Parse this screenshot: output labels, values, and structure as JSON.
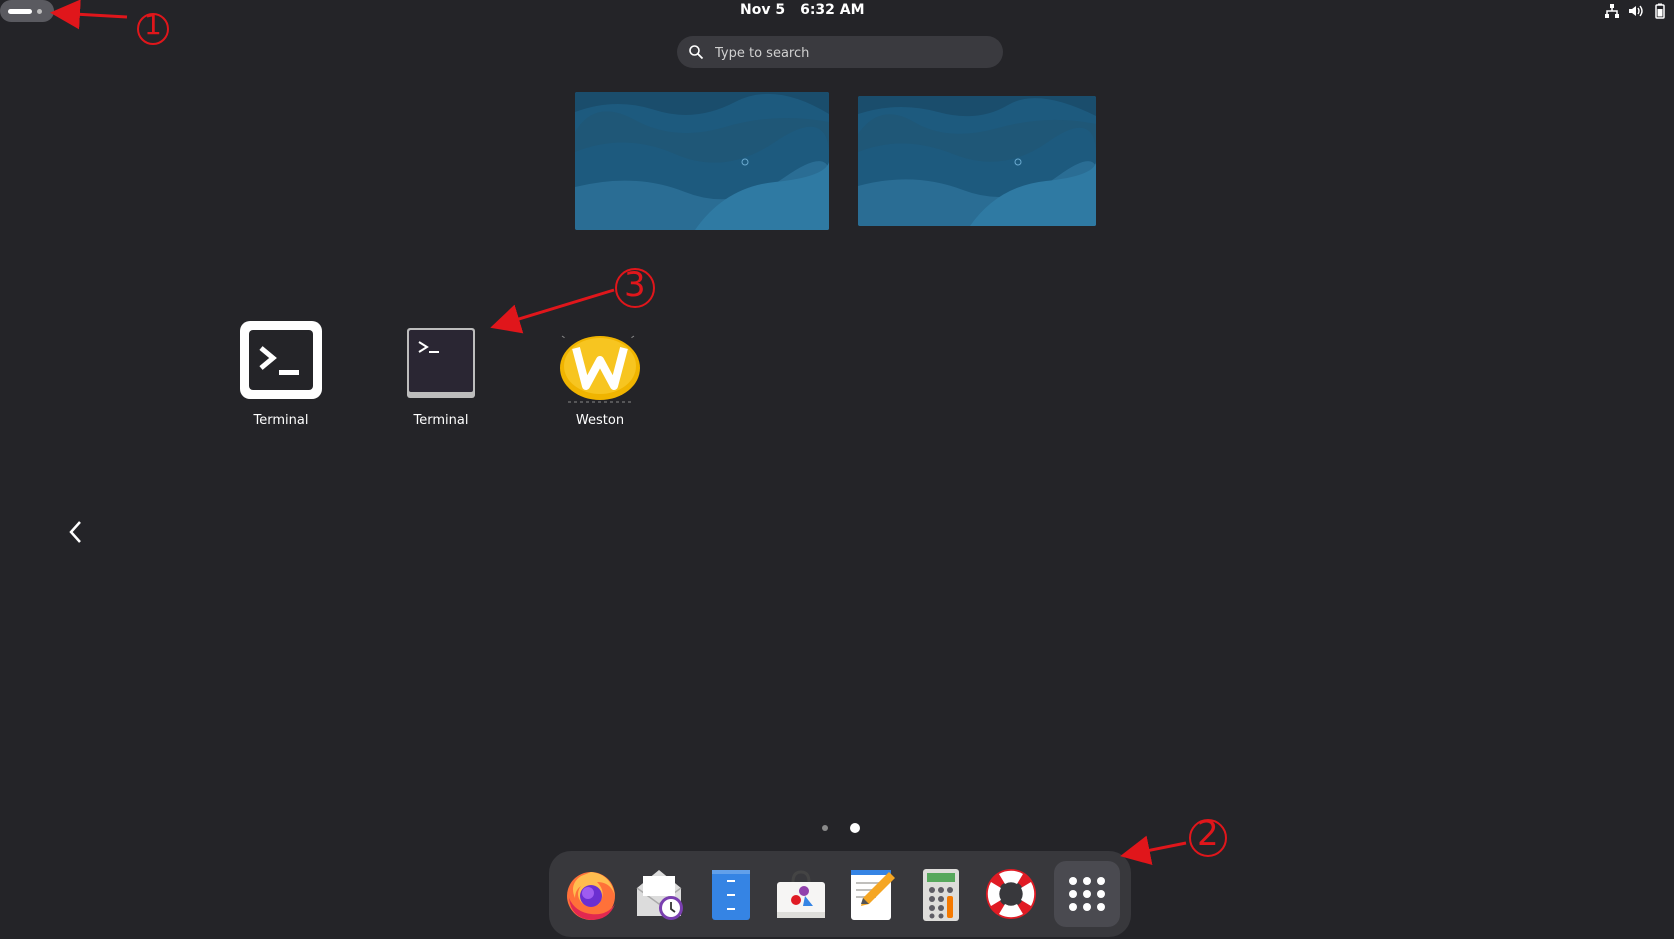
{
  "topbar": {
    "date": "Nov 5",
    "time": "6:32 AM",
    "tray_icons": [
      "network-icon",
      "volume-icon",
      "battery-icon"
    ]
  },
  "search": {
    "placeholder": "Type to search"
  },
  "app_grid": {
    "apps": [
      {
        "label": "Terminal",
        "icon": "terminal-icon"
      },
      {
        "label": "Terminal",
        "icon": "terminal-dark-icon"
      },
      {
        "label": "Weston",
        "icon": "weston-icon"
      }
    ],
    "pages": 2,
    "current_page": 2
  },
  "dock": {
    "apps": [
      "firefox-icon",
      "mail-clock-icon",
      "files-icon",
      "software-center-icon",
      "text-editor-icon",
      "calculator-icon",
      "help-icon",
      "show-apps-icon"
    ]
  },
  "annotations": {
    "labels": [
      "1",
      "2",
      "3"
    ],
    "color": "#e0161b"
  },
  "colors": {
    "background": "#242428",
    "dock": "#38383c",
    "search": "#3a3a3f"
  }
}
